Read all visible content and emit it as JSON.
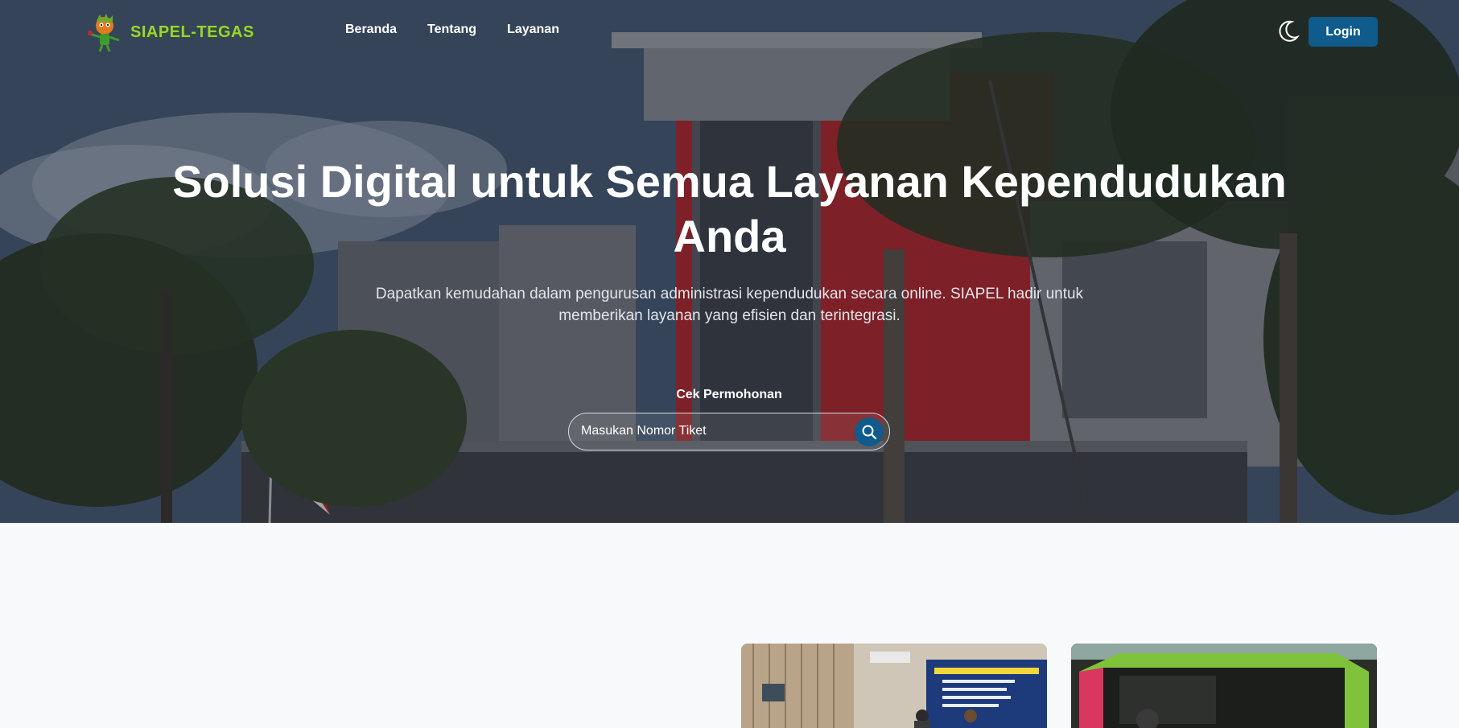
{
  "brand": {
    "name": "SIAPEL-TEGAS",
    "logo_icon": "mascot-logo-icon"
  },
  "nav": {
    "items": [
      {
        "label": "Beranda"
      },
      {
        "label": "Tentang"
      },
      {
        "label": "Layanan"
      }
    ]
  },
  "header": {
    "theme_icon": "moon-icon",
    "login_label": "Login"
  },
  "hero": {
    "title": "Solusi Digital untuk Semua Layanan Kependudukan Anda",
    "subtitle": "Dapatkan kemudahan dalam pengurusan administrasi kependudukan secara online. SIAPEL hadir untuk memberikan layanan yang efisien dan terintegrasi.",
    "search_label": "Cek Permohonan",
    "search_placeholder": "Masukan Nomor Tiket",
    "search_icon": "search-icon"
  },
  "colors": {
    "primary": "#0e5b8c",
    "accent_green": "#9bd13a",
    "page_bg": "#f8f9fb",
    "building_red": "#c8242a"
  }
}
